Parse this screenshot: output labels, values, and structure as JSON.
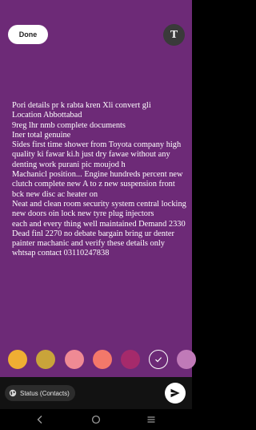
{
  "header": {
    "done_label": "Done",
    "font_button_label": "T"
  },
  "status_text": "Pori details pr k rabta kren Xli convert gli\nLocation Abbottabad\n9reg lhr nmb complete documents\nIner total genuine\nSides first time shower from Toyota company high quality ki fawar ki.h just dry fawae without any denting work purani pic moujod h\nMachanicl position... Engine hundreds percent new clutch complete new A to z new suspension front bck new disc ac heater on\nNeat and clean room security system central locking new doors oin lock new tyre plug injectors\neach and every thing well maintained Demand 2330 Dead finl 2270 no debate bargain bring ur denter painter machanic and verify these details only whtsap contact 03110247838",
  "palette": {
    "colors": [
      "#efae33",
      "#c9a43a",
      "#ef8a94",
      "#f3786a",
      "#a52a6b",
      "#6d2a77",
      "#c07ab8"
    ],
    "selected_index": 5
  },
  "composer": {
    "audience_label": "Status (Contacts)",
    "audience_icon": "globe-icon",
    "send_icon": "send-icon"
  },
  "navbar": {
    "back_icon": "back-icon",
    "home_icon": "home-icon",
    "recents_icon": "recents-icon"
  }
}
